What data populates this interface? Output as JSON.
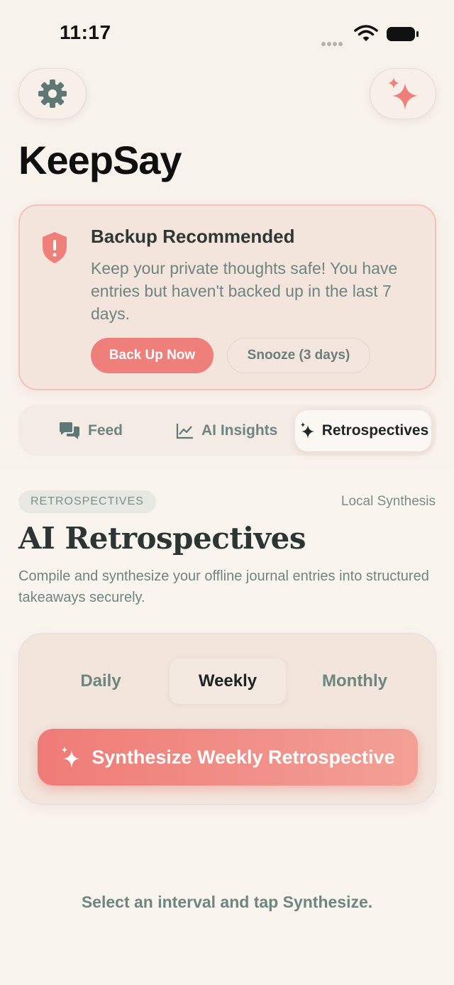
{
  "status_bar": {
    "time": "11:17"
  },
  "app": {
    "title": "KeepSay"
  },
  "header": {
    "settings_icon": "gear-icon",
    "ai_icon": "sparkles-icon"
  },
  "backup_card": {
    "title": "Backup Recommended",
    "message": "Keep your private thoughts safe! You have entries but haven't backed up in the last 7 days.",
    "primary_label": "Back Up Now",
    "secondary_label": "Snooze (3 days)"
  },
  "tabs": [
    {
      "label": "Feed",
      "icon": "chat-bubbles-icon",
      "active": false
    },
    {
      "label": "AI Insights",
      "icon": "chart-line-icon",
      "active": false
    },
    {
      "label": "Retrospectives",
      "icon": "sparkles-icon",
      "active": true
    }
  ],
  "retro": {
    "badge": "RETROSPECTIVES",
    "tag": "Local Synthesis",
    "title": "AI Retrospectives",
    "subtitle": "Compile and synthesize your offline journal entries into structured takeaways securely.",
    "intervals": [
      "Daily",
      "Weekly",
      "Monthly"
    ],
    "selected_interval": "Weekly",
    "synthesize_label": "Synthesize Weekly Retrospective",
    "hint": "Select an interval and tap Synthesize."
  },
  "colors": {
    "accent": "#ef7f7a",
    "muted_text": "#6e8580",
    "background": "#f8f2ec"
  }
}
